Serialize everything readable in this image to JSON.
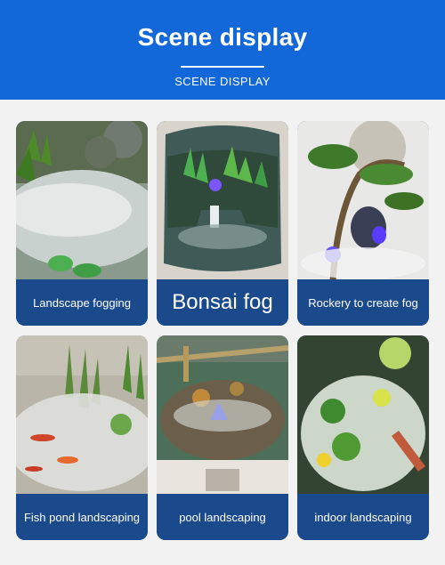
{
  "header": {
    "title": "Scene display",
    "subtitle": "SCENE DISPLAY",
    "background": "#1268d8"
  },
  "cards": [
    {
      "label": "Landscape fogging"
    },
    {
      "label": "Bonsai fog"
    },
    {
      "label": "Rockery to create fog"
    },
    {
      "label": "Fish pond landscaping"
    },
    {
      "label": "pool landscaping"
    },
    {
      "label": "indoor landscaping"
    }
  ],
  "colors": {
    "label_bg": "#1b4a8c",
    "label_text": "#ffffff",
    "page_bg": "#f2f2f2"
  }
}
